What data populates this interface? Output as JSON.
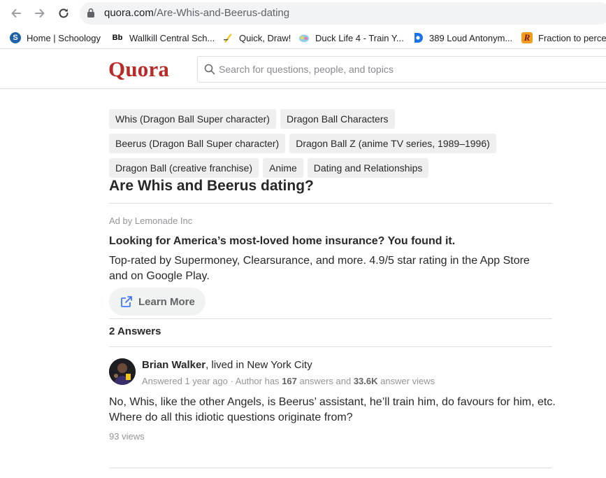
{
  "browser": {
    "url_domain": "quora.com",
    "url_path": "/Are-Whis-and-Beerus-dating",
    "bookmarks": [
      {
        "label": "Home | Schoology",
        "icon": "schoology-icon"
      },
      {
        "label": "Wallkill Central Sch...",
        "icon": "blackboard-icon",
        "icon_text": "Bb"
      },
      {
        "label": "Quick, Draw!",
        "icon": "quickdraw-icon"
      },
      {
        "label": "Duck Life 4 - Train Y...",
        "icon": "ducklife-icon"
      },
      {
        "label": "389 Loud Antonym...",
        "icon": "dictionary-icon"
      },
      {
        "label": "Fraction to percent",
        "icon": "r-icon",
        "icon_text": "R"
      }
    ]
  },
  "header": {
    "logo": "Quora",
    "search_placeholder": "Search for questions, people, and topics"
  },
  "question": {
    "topics": [
      "Whis (Dragon Ball Super character)",
      "Dragon Ball Characters",
      "Beerus (Dragon Ball Super character)",
      "Dragon Ball Z (anime TV series, 1989–1996)",
      "Dragon Ball (creative franchise)",
      "Anime",
      "Dating and Relationships"
    ],
    "title": "Are Whis and Beerus dating?"
  },
  "ad": {
    "by": "Ad by Lemonade Inc",
    "title": "Looking for America’s most-loved home insurance? You found it.",
    "description": "Top-rated by Supermoney, Clearsurance, and more. 4.9/5 star rating in the App Store and on Google Play.",
    "button": "Learn More"
  },
  "answers": {
    "count_label": "2 Answers",
    "items": [
      {
        "author": "Brian Walker",
        "credential": ", lived in New York City",
        "answered": "Answered 1 year ago · Author has ",
        "answers_count": "167",
        "answers_mid": " answers and ",
        "answer_views": "33.6K",
        "answer_views_suffix": " answer views",
        "text": "No, Whis, like the other Angels, is Beerus’ assistant, he’ll train him, do favours for him, etc. Where do all this idiotic questions originate from?",
        "views": "93 views"
      }
    ]
  },
  "colors": {
    "brand": "#b92b27",
    "topic_bg": "#efefef",
    "muted": "#939598"
  }
}
